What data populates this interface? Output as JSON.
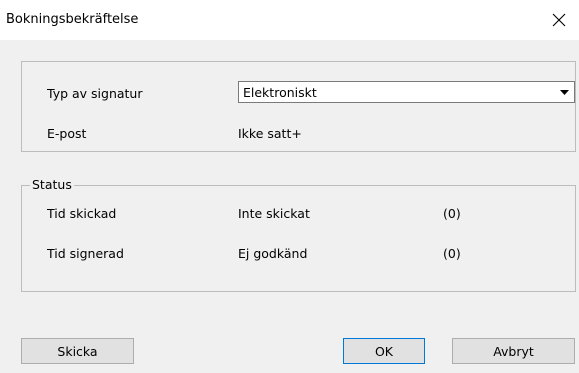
{
  "window": {
    "title": "Bokningsbekräftelse",
    "close_icon": "close-icon"
  },
  "signature": {
    "type_label": "Typ av signatur",
    "type_value": "Elektroniskt",
    "email_label": "E-post",
    "email_value": "Ikke satt+"
  },
  "status": {
    "legend": "Status",
    "rows": [
      {
        "label": "Tid skickad",
        "value": "Inte skickat",
        "count": "(0)"
      },
      {
        "label": "Tid signerad",
        "value": "Ej godkänd",
        "count": "(0)"
      }
    ]
  },
  "buttons": {
    "send": "Skicka",
    "ok": "OK",
    "cancel": "Avbryt"
  }
}
